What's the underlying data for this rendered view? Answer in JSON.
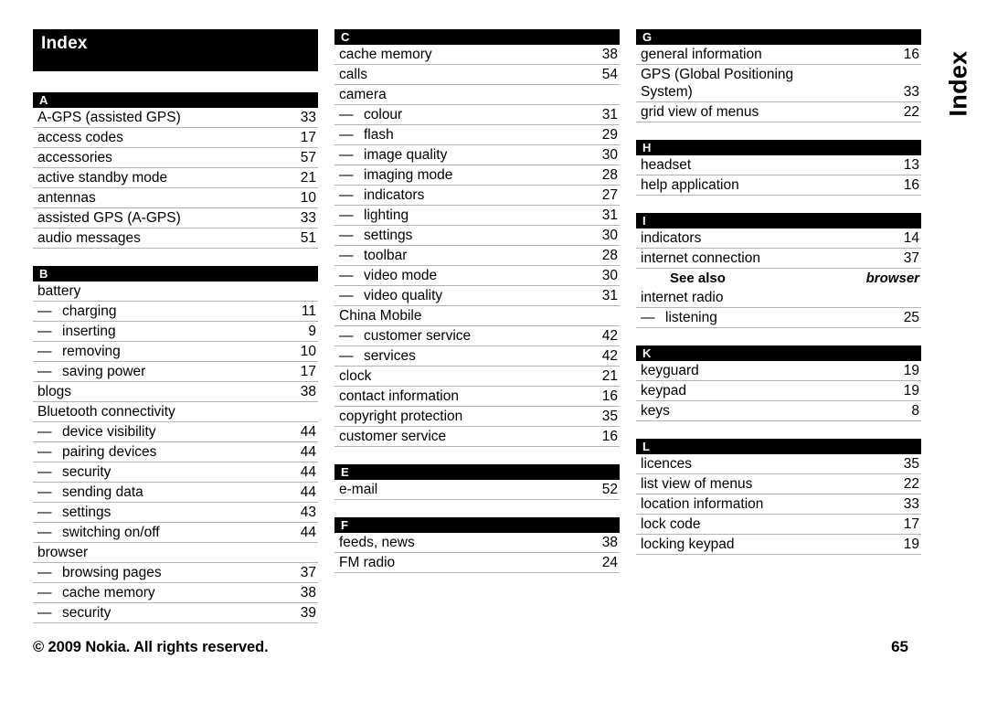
{
  "title": "Index",
  "side_tab": "Index",
  "footer": {
    "copyright": "© 2009 Nokia. All rights reserved.",
    "page_number": "65"
  },
  "columns": [
    {
      "sections": [
        {
          "letter": "A",
          "entries": [
            {
              "label": "A-GPS (assisted GPS)",
              "page": "33"
            },
            {
              "label": "access codes",
              "page": "17"
            },
            {
              "label": "accessories",
              "page": "57"
            },
            {
              "label": "active standby mode",
              "page": "21"
            },
            {
              "label": "antennas",
              "page": "10"
            },
            {
              "label": "assisted GPS (A-GPS)",
              "page": "33"
            },
            {
              "label": "audio messages",
              "page": "51"
            }
          ]
        },
        {
          "letter": "B",
          "entries": [
            {
              "label": "battery",
              "page": ""
            },
            {
              "sub": true,
              "label": "charging",
              "page": "11"
            },
            {
              "sub": true,
              "label": "inserting",
              "page": "9"
            },
            {
              "sub": true,
              "label": "removing",
              "page": "10"
            },
            {
              "sub": true,
              "label": "saving power",
              "page": "17"
            },
            {
              "label": "blogs",
              "page": "38"
            },
            {
              "label": "Bluetooth connectivity",
              "page": ""
            },
            {
              "sub": true,
              "label": "device visibility",
              "page": "44"
            },
            {
              "sub": true,
              "label": "pairing devices",
              "page": "44"
            },
            {
              "sub": true,
              "label": "security",
              "page": "44"
            },
            {
              "sub": true,
              "label": "sending data",
              "page": "44"
            },
            {
              "sub": true,
              "label": "settings",
              "page": "43"
            },
            {
              "sub": true,
              "label": "switching on/off",
              "page": "44"
            },
            {
              "label": "browser",
              "page": ""
            },
            {
              "sub": true,
              "label": "browsing pages",
              "page": "37"
            },
            {
              "sub": true,
              "label": "cache memory",
              "page": "38"
            },
            {
              "sub": true,
              "label": "security",
              "page": "39"
            }
          ]
        }
      ]
    },
    {
      "sections": [
        {
          "letter": "C",
          "entries": [
            {
              "label": "cache memory",
              "page": "38"
            },
            {
              "label": "calls",
              "page": "54"
            },
            {
              "label": "camera",
              "page": ""
            },
            {
              "sub": true,
              "label": "colour",
              "page": "31"
            },
            {
              "sub": true,
              "label": "flash",
              "page": "29"
            },
            {
              "sub": true,
              "label": "image quality",
              "page": "30"
            },
            {
              "sub": true,
              "label": "imaging mode",
              "page": "28"
            },
            {
              "sub": true,
              "label": "indicators",
              "page": "27"
            },
            {
              "sub": true,
              "label": "lighting",
              "page": "31"
            },
            {
              "sub": true,
              "label": "settings",
              "page": "30"
            },
            {
              "sub": true,
              "label": "toolbar",
              "page": "28"
            },
            {
              "sub": true,
              "label": "video mode",
              "page": "30"
            },
            {
              "sub": true,
              "label": "video quality",
              "page": "31"
            },
            {
              "label": "China Mobile",
              "page": ""
            },
            {
              "sub": true,
              "label": "customer service",
              "page": "42"
            },
            {
              "sub": true,
              "label": "services",
              "page": "42"
            },
            {
              "label": "clock",
              "page": "21"
            },
            {
              "label": "contact information",
              "page": "16"
            },
            {
              "label": "copyright protection",
              "page": "35"
            },
            {
              "label": "customer service",
              "page": "16"
            }
          ]
        },
        {
          "letter": "E",
          "entries": [
            {
              "label": "e-mail",
              "page": "52"
            }
          ]
        },
        {
          "letter": "F",
          "entries": [
            {
              "label": "feeds, news",
              "page": "38"
            },
            {
              "label": "FM radio",
              "page": "24"
            }
          ]
        }
      ]
    },
    {
      "sections": [
        {
          "letter": "G",
          "entries": [
            {
              "label": "general information",
              "page": "16"
            },
            {
              "wrap": true,
              "line1": "GPS (Global Positioning",
              "line2": "System)",
              "page": "33"
            },
            {
              "label": "grid view of menus",
              "page": "22"
            }
          ]
        },
        {
          "letter": "H",
          "entries": [
            {
              "label": "headset",
              "page": "13"
            },
            {
              "label": "help application",
              "page": "16"
            }
          ]
        },
        {
          "letter": "I",
          "entries": [
            {
              "label": "indicators",
              "page": "14"
            },
            {
              "label": "internet connection",
              "page": "37"
            },
            {
              "seealso": true,
              "prefix": "See also ",
              "target": "browser"
            },
            {
              "label": "internet radio",
              "page": ""
            },
            {
              "sub": true,
              "label": "listening",
              "page": "25"
            }
          ]
        },
        {
          "letter": "K",
          "entries": [
            {
              "label": "keyguard",
              "page": "19"
            },
            {
              "label": "keypad",
              "page": "19"
            },
            {
              "label": "keys",
              "page": "8"
            }
          ]
        },
        {
          "letter": "L",
          "entries": [
            {
              "label": "licences",
              "page": "35"
            },
            {
              "label": "list view of menus",
              "page": "22"
            },
            {
              "label": "location information",
              "page": "33"
            },
            {
              "label": "lock code",
              "page": "17"
            },
            {
              "label": "locking keypad",
              "page": "19"
            }
          ]
        }
      ]
    }
  ]
}
